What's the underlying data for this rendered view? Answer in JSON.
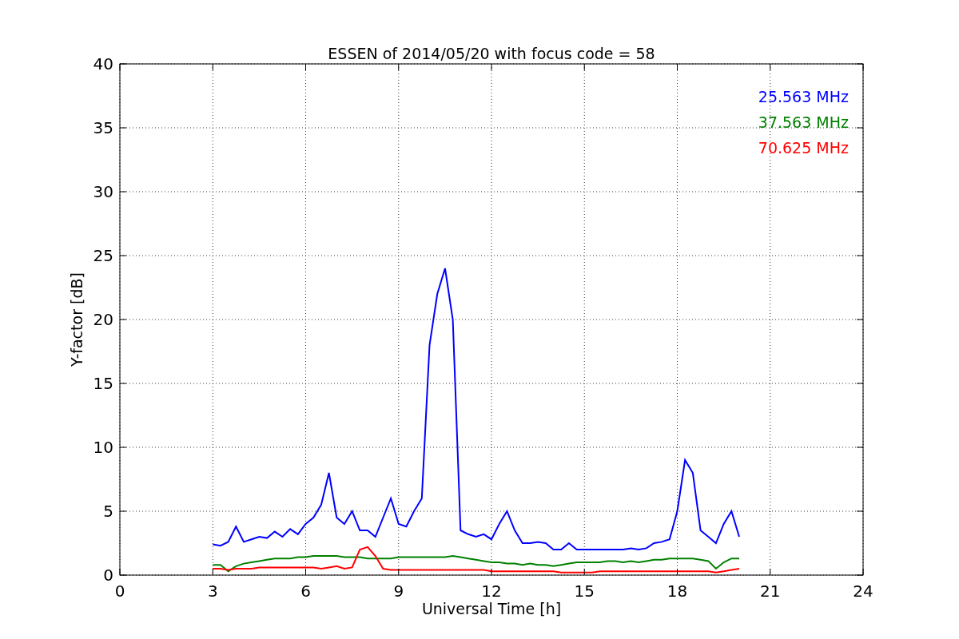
{
  "figure": {
    "chart_data": {
      "type": "line",
      "title": "ESSEN of 2014/05/20 with focus code = 58",
      "xlabel": "Universal Time [h]",
      "ylabel": "Y-factor [dB]",
      "x": [
        3,
        3.25,
        3.5,
        3.75,
        4,
        4.25,
        4.5,
        4.75,
        5,
        5.25,
        5.5,
        5.75,
        6,
        6.25,
        6.5,
        6.75,
        7,
        7.25,
        7.5,
        7.75,
        8,
        8.25,
        8.5,
        8.75,
        9,
        9.25,
        9.5,
        9.75,
        10,
        10.25,
        10.5,
        10.75,
        11,
        11.25,
        11.5,
        11.75,
        12,
        12.25,
        12.5,
        12.75,
        13,
        13.25,
        13.5,
        13.75,
        14,
        14.25,
        14.5,
        14.75,
        15,
        15.25,
        15.5,
        15.75,
        16,
        16.25,
        16.5,
        16.75,
        17,
        17.25,
        17.5,
        17.75,
        18,
        18.25,
        18.5,
        18.75,
        19,
        19.25,
        19.5,
        19.75,
        20
      ],
      "series": [
        {
          "name": "25.563 MHz",
          "color": "#0000ff",
          "values": [
            2.4,
            2.3,
            2.6,
            3.8,
            2.6,
            2.8,
            3.0,
            2.9,
            3.4,
            3.0,
            3.6,
            3.2,
            4.0,
            4.5,
            5.5,
            8.0,
            4.5,
            4.0,
            5.0,
            3.5,
            3.5,
            3.0,
            4.5,
            6.0,
            4.0,
            3.8,
            5.0,
            6.0,
            18,
            22,
            24,
            20,
            3.5,
            3.2,
            3.0,
            3.2,
            2.8,
            4.0,
            5.0,
            3.5,
            2.5,
            2.5,
            2.6,
            2.5,
            2.0,
            2.0,
            2.5,
            2.0,
            2.0,
            2.0,
            2.0,
            2.0,
            2.0,
            2.0,
            2.1,
            2.0,
            2.1,
            2.5,
            2.6,
            2.8,
            5.0,
            9.0,
            8.0,
            3.5,
            3.0,
            2.5,
            4.0,
            5.0,
            3.0
          ]
        },
        {
          "name": "37.563 MHz",
          "color": "#008000",
          "values": [
            0.8,
            0.8,
            0.3,
            0.7,
            0.9,
            1.0,
            1.1,
            1.2,
            1.3,
            1.3,
            1.3,
            1.4,
            1.4,
            1.5,
            1.5,
            1.5,
            1.5,
            1.4,
            1.4,
            1.4,
            1.3,
            1.3,
            1.3,
            1.3,
            1.4,
            1.4,
            1.4,
            1.4,
            1.4,
            1.4,
            1.4,
            1.5,
            1.4,
            1.3,
            1.2,
            1.1,
            1.0,
            1.0,
            0.9,
            0.9,
            0.8,
            0.9,
            0.8,
            0.8,
            0.7,
            0.8,
            0.9,
            1.0,
            1.0,
            1.0,
            1.0,
            1.1,
            1.1,
            1.0,
            1.1,
            1.0,
            1.1,
            1.2,
            1.2,
            1.3,
            1.3,
            1.3,
            1.3,
            1.2,
            1.1,
            0.5,
            1.0,
            1.3,
            1.3
          ]
        },
        {
          "name": "70.625 MHz",
          "color": "#ff0000",
          "values": [
            0.5,
            0.5,
            0.4,
            0.5,
            0.5,
            0.5,
            0.6,
            0.6,
            0.6,
            0.6,
            0.6,
            0.6,
            0.6,
            0.6,
            0.5,
            0.6,
            0.7,
            0.5,
            0.6,
            2.0,
            2.2,
            1.5,
            0.5,
            0.4,
            0.4,
            0.4,
            0.4,
            0.4,
            0.4,
            0.4,
            0.4,
            0.4,
            0.4,
            0.4,
            0.4,
            0.4,
            0.3,
            0.3,
            0.3,
            0.3,
            0.3,
            0.3,
            0.3,
            0.3,
            0.3,
            0.2,
            0.2,
            0.2,
            0.2,
            0.2,
            0.3,
            0.3,
            0.3,
            0.3,
            0.3,
            0.3,
            0.3,
            0.3,
            0.3,
            0.3,
            0.3,
            0.3,
            0.3,
            0.3,
            0.3,
            0.2,
            0.3,
            0.4,
            0.5
          ]
        }
      ],
      "grid": true,
      "xlim": [
        0,
        24
      ],
      "ylim": [
        0,
        40
      ],
      "xticks": [
        0,
        3,
        6,
        9,
        12,
        15,
        18,
        21,
        24
      ],
      "yticks": [
        0,
        5,
        10,
        15,
        20,
        25,
        30,
        35,
        40
      ]
    }
  }
}
